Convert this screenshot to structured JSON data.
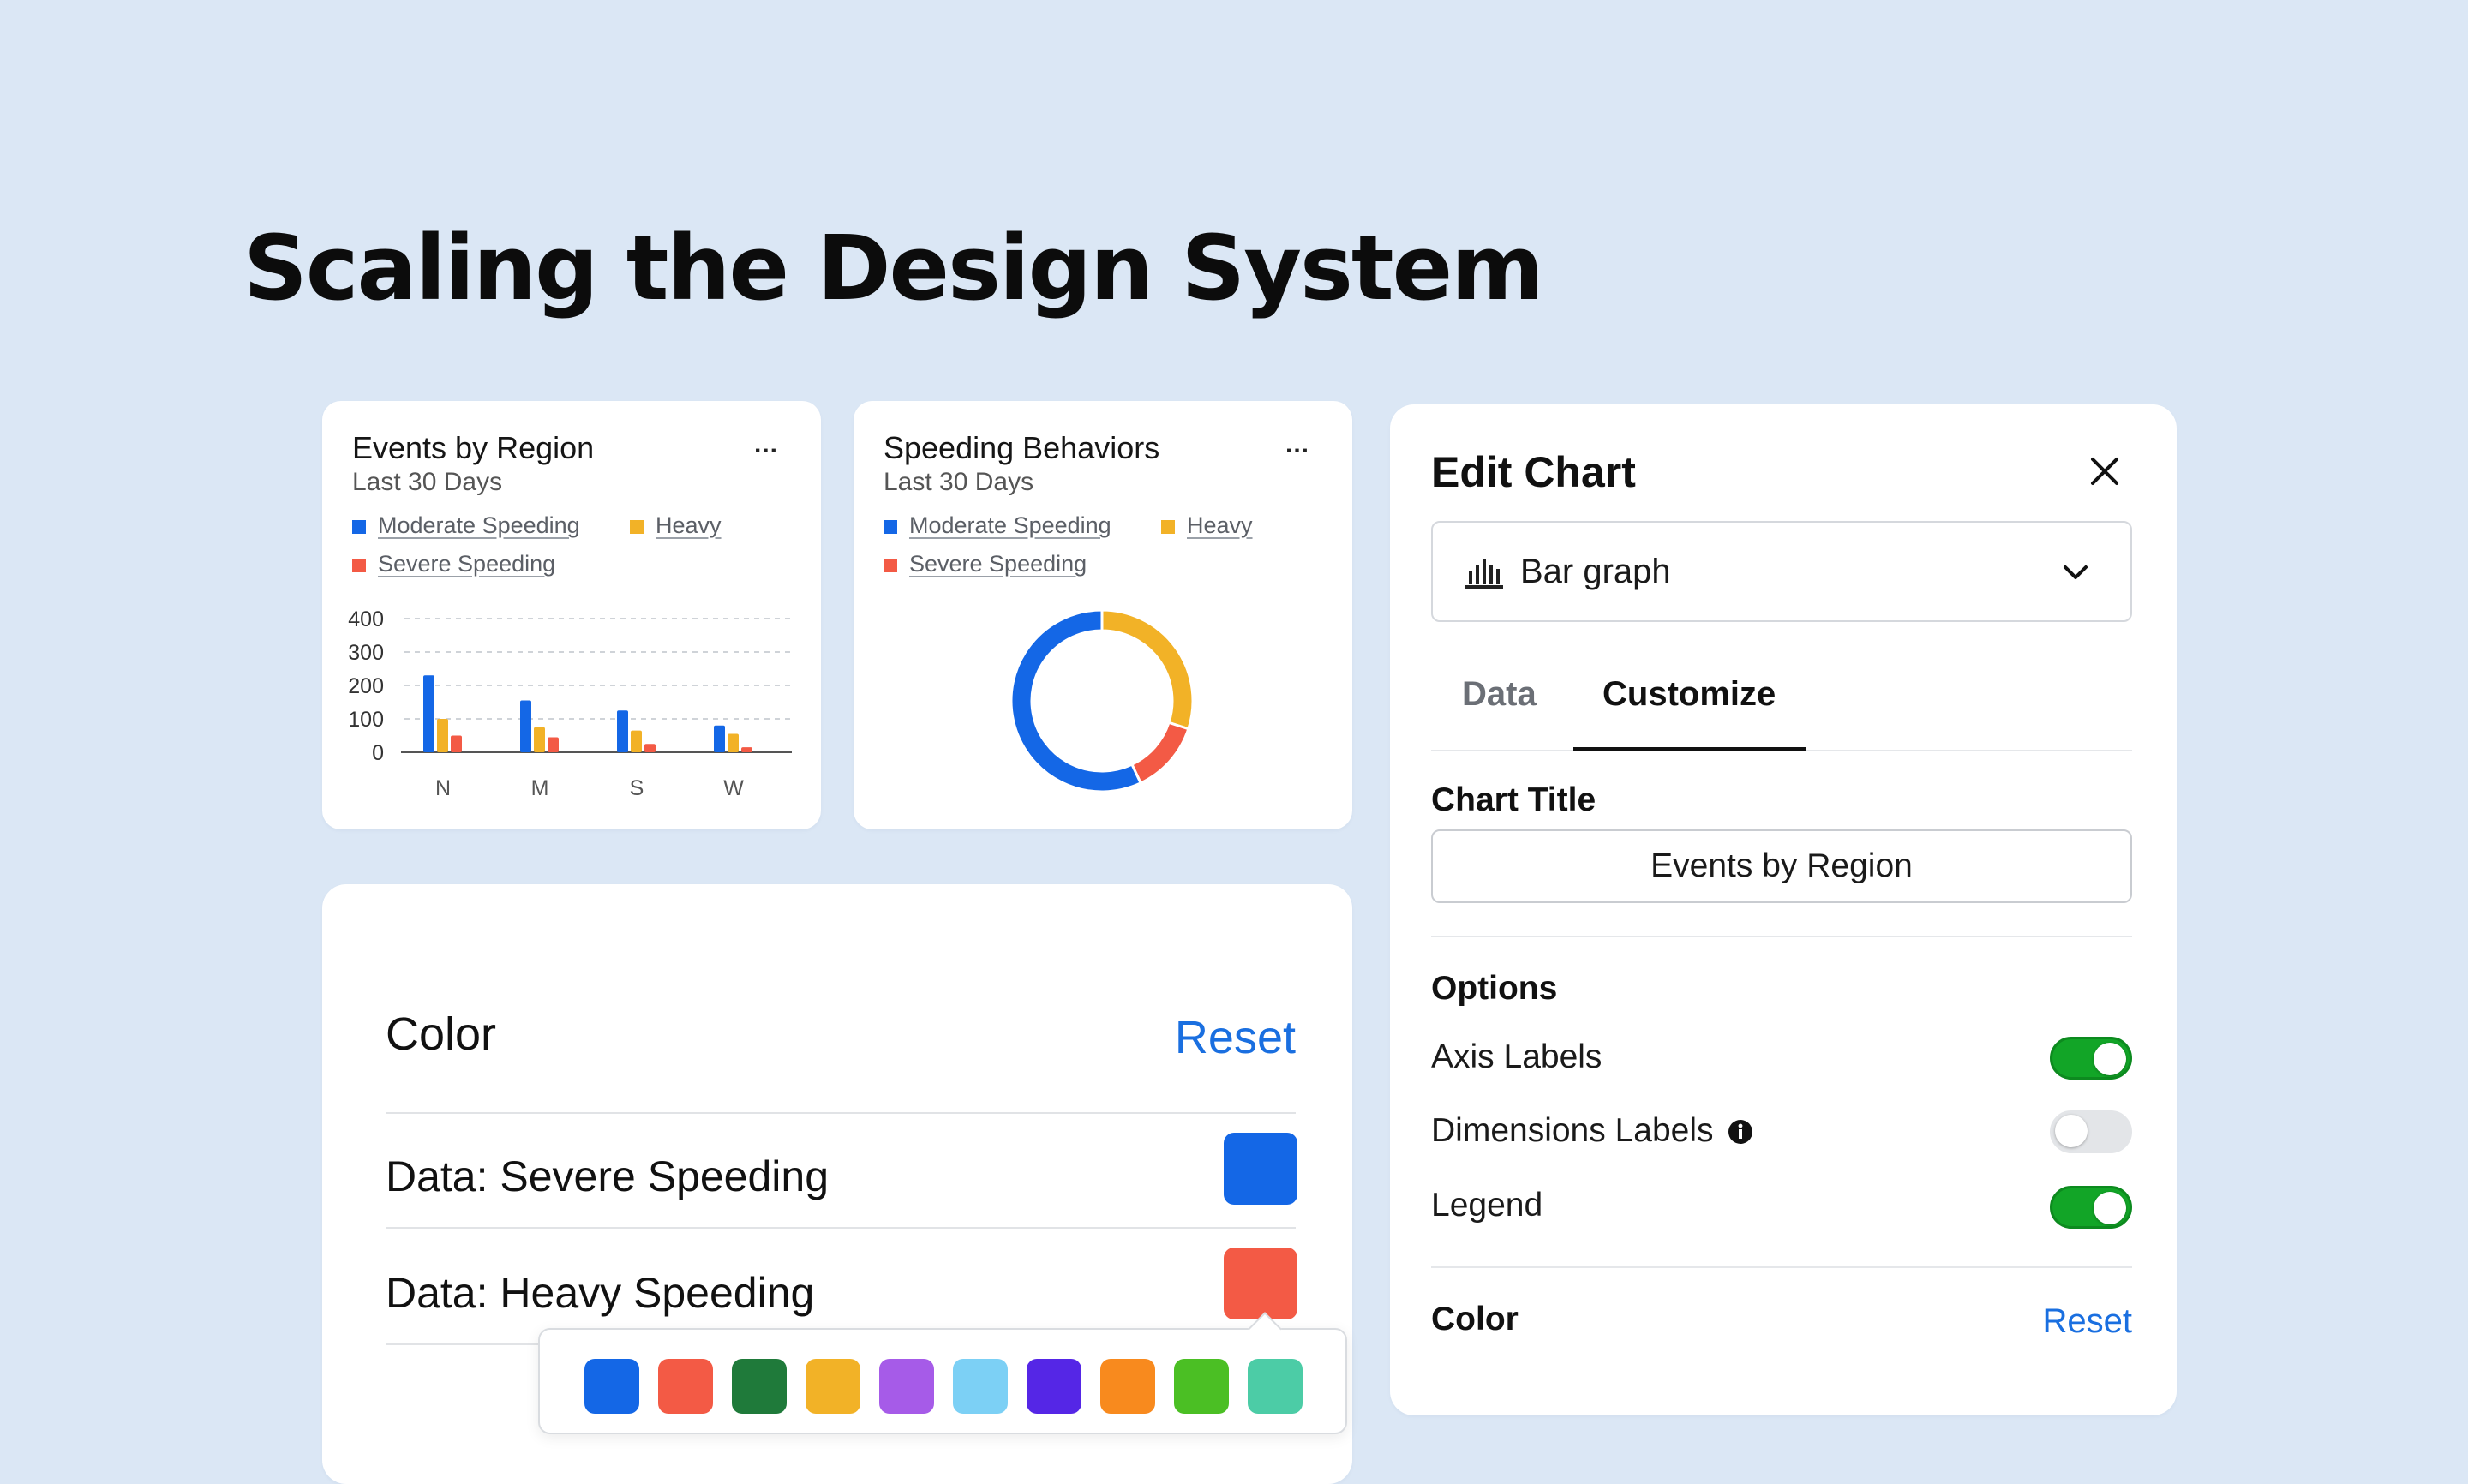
{
  "headline": "Scaling the Design System",
  "events_card": {
    "title": "Events by Region",
    "subtitle": "Last 30 Days",
    "menu": "...",
    "legend": [
      "Moderate Speeding",
      "Heavy",
      "Severe Speeding"
    ],
    "y_ticks": [
      "400",
      "300",
      "200",
      "100",
      "0"
    ],
    "x_ticks": [
      "N",
      "M",
      "S",
      "W"
    ]
  },
  "speeding_card": {
    "title": "Speeding Behaviors",
    "subtitle": "Last 30 Days",
    "menu": "...",
    "legend": [
      "Moderate Speeding",
      "Heavy",
      "Severe Speeding"
    ]
  },
  "colors": {
    "moderate": "#1467e6",
    "heavy": "#f2b227",
    "severe": "#f35a45",
    "accent": "#1a6fe0",
    "toggle_on": "#12a527"
  },
  "chart_data": [
    {
      "type": "bar",
      "categories": [
        "N",
        "M",
        "S",
        "W"
      ],
      "series": [
        {
          "name": "Moderate Speeding",
          "values": [
            230,
            155,
            125,
            80
          ]
        },
        {
          "name": "Heavy",
          "values": [
            100,
            75,
            65,
            55
          ]
        },
        {
          "name": "Severe Speeding",
          "values": [
            50,
            45,
            25,
            15
          ]
        }
      ],
      "title": "Events by Region",
      "subtitle": "Last 30 Days",
      "ylim": [
        0,
        400
      ],
      "y_ticks": [
        0,
        100,
        200,
        300,
        400
      ],
      "grid": true,
      "legend": "top"
    },
    {
      "type": "pie",
      "donut": true,
      "title": "Speeding Behaviors",
      "subtitle": "Last 30 Days",
      "slices": [
        {
          "name": "Moderate Speeding",
          "value": 57
        },
        {
          "name": "Heavy",
          "value": 30
        },
        {
          "name": "Severe Speeding",
          "value": 13
        }
      ],
      "legend": "top"
    }
  ],
  "edit_panel": {
    "title": "Edit Chart",
    "chart_type": "Bar graph",
    "tabs": [
      "Data",
      "Customize"
    ],
    "active_tab": "Customize",
    "chart_title_label": "Chart Title",
    "chart_title_value": "Events by Region",
    "options_label": "Options",
    "options": [
      {
        "label": "Axis Labels",
        "enabled": true
      },
      {
        "label": "Dimensions Labels",
        "enabled": false
      },
      {
        "label": "Legend",
        "enabled": true
      }
    ],
    "color_label": "Color",
    "reset_label": "Reset"
  },
  "color_card": {
    "title": "Color",
    "reset_label": "Reset",
    "rows": [
      {
        "label": "Data: Severe Speeding",
        "color": "#1467e6"
      },
      {
        "label": "Data: Heavy Speeding",
        "color": "#f35a45"
      }
    ]
  },
  "palette": [
    "#1467e6",
    "#f35a45",
    "#1f7a3a",
    "#f2b227",
    "#a65be8",
    "#7cd0f5",
    "#5526e6",
    "#f88a1e",
    "#4bbf24",
    "#4ccca6"
  ]
}
